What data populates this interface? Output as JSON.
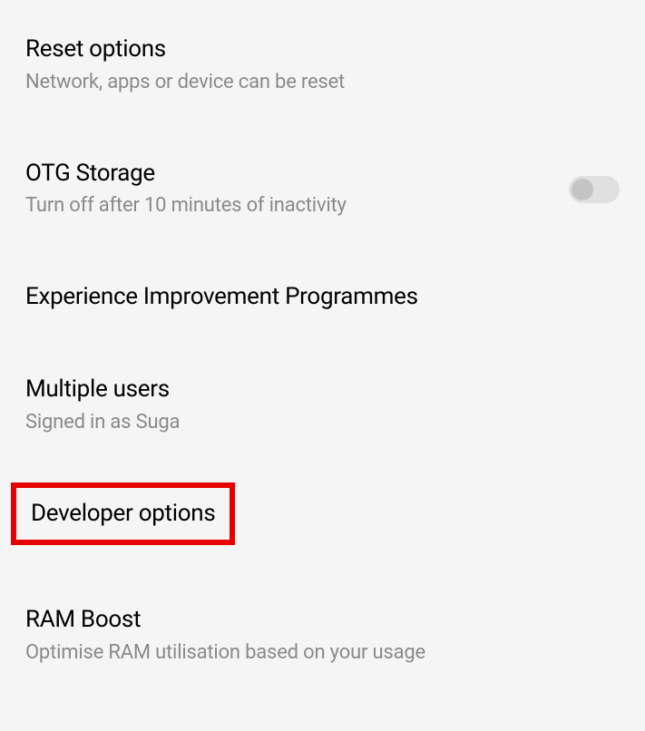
{
  "settings": {
    "reset_options": {
      "title": "Reset options",
      "subtitle": "Network, apps or device can be reset"
    },
    "otg_storage": {
      "title": "OTG Storage",
      "subtitle": "Turn off after 10 minutes of inactivity",
      "toggle_state": "off"
    },
    "experience_improvement": {
      "title": "Experience Improvement Programmes"
    },
    "multiple_users": {
      "title": "Multiple users",
      "subtitle": "Signed in as Suga"
    },
    "developer_options": {
      "title": "Developer options"
    },
    "ram_boost": {
      "title": "RAM Boost",
      "subtitle": "Optimise RAM utilisation based on your usage"
    }
  }
}
